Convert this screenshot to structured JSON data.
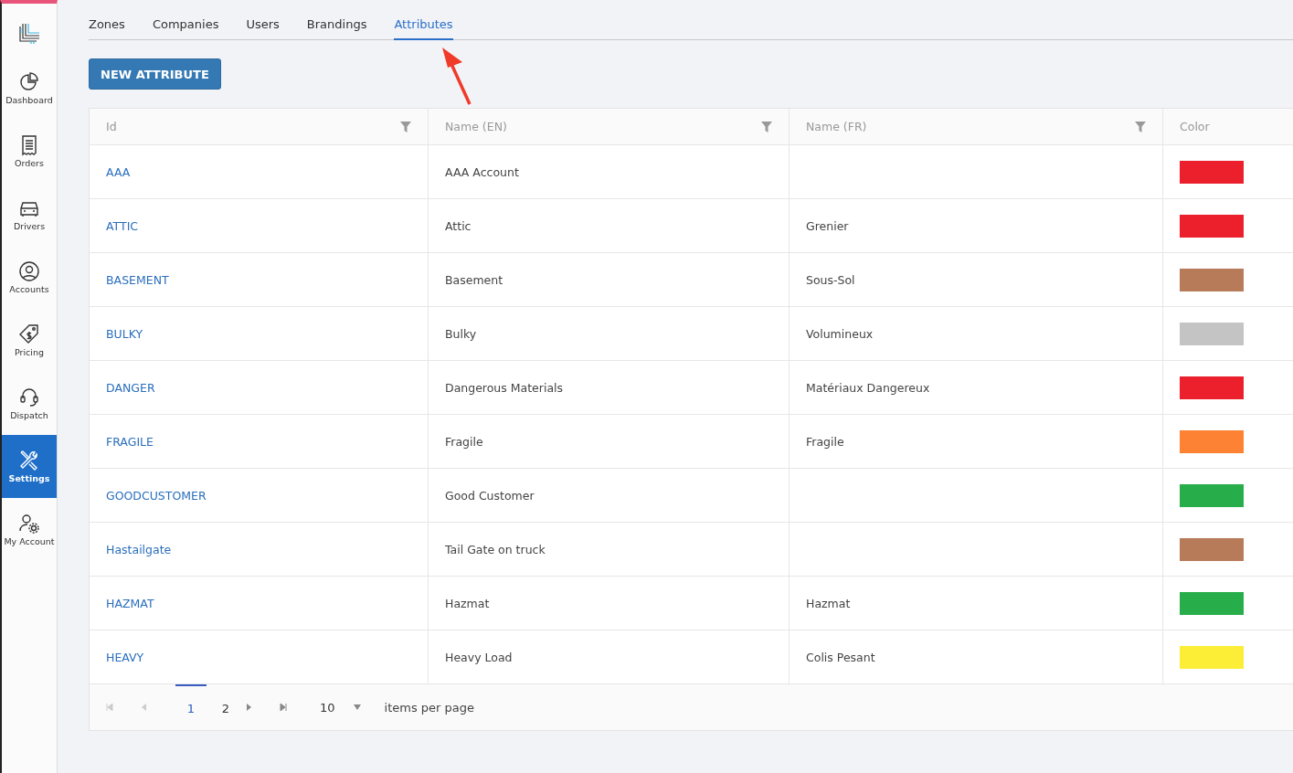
{
  "sidebar": {
    "items": [
      {
        "label": "Dashboard",
        "selected": false
      },
      {
        "label": "Orders",
        "selected": false
      },
      {
        "label": "Drivers",
        "selected": false
      },
      {
        "label": "Accounts",
        "selected": false
      },
      {
        "label": "Pricing",
        "selected": false
      },
      {
        "label": "Dispatch",
        "selected": false
      },
      {
        "label": "Settings",
        "selected": true
      },
      {
        "label": "My Account",
        "selected": false
      }
    ]
  },
  "tabs": [
    {
      "label": "Zones",
      "selected": false
    },
    {
      "label": "Companies",
      "selected": false
    },
    {
      "label": "Users",
      "selected": false
    },
    {
      "label": "Brandings",
      "selected": false
    },
    {
      "label": "Attributes",
      "selected": true
    }
  ],
  "new_button": "NEW ATTRIBUTE",
  "table": {
    "columns": [
      {
        "label": "Id",
        "filter": true
      },
      {
        "label": "Name (EN)",
        "filter": true
      },
      {
        "label": "Name (FR)",
        "filter": true
      },
      {
        "label": "Color",
        "filter": false
      }
    ],
    "rows": [
      {
        "id": "AAA",
        "name_en": "AAA Account",
        "name_fr": "",
        "color": "#ec1f2d"
      },
      {
        "id": "ATTIC",
        "name_en": "Attic",
        "name_fr": "Grenier",
        "color": "#ec1f2d"
      },
      {
        "id": "BASEMENT",
        "name_en": "Basement",
        "name_fr": "Sous-Sol",
        "color": "#b77b5a"
      },
      {
        "id": "BULKY",
        "name_en": "Bulky",
        "name_fr": "Volumineux",
        "color": "#c4c4c4"
      },
      {
        "id": "DANGER",
        "name_en": "Dangerous Materials",
        "name_fr": "Matériaux Dangereux",
        "color": "#ec1f2d"
      },
      {
        "id": "FRAGILE",
        "name_en": "Fragile",
        "name_fr": "Fragile",
        "color": "#fd8234"
      },
      {
        "id": "GOODCUSTOMER",
        "name_en": "Good Customer",
        "name_fr": "",
        "color": "#27ae4a"
      },
      {
        "id": "Hastailgate",
        "name_en": "Tail Gate on truck",
        "name_fr": "",
        "color": "#b77b5a"
      },
      {
        "id": "HAZMAT",
        "name_en": "Hazmat",
        "name_fr": "Hazmat",
        "color": "#27ae4a"
      },
      {
        "id": "HEAVY",
        "name_en": "Heavy Load",
        "name_fr": "Colis Pesant",
        "color": "#fcee37"
      }
    ]
  },
  "pager": {
    "pages": [
      {
        "label": "1",
        "selected": true
      },
      {
        "label": "2",
        "selected": false
      }
    ],
    "page_size": "10",
    "page_size_label": "items per page"
  }
}
